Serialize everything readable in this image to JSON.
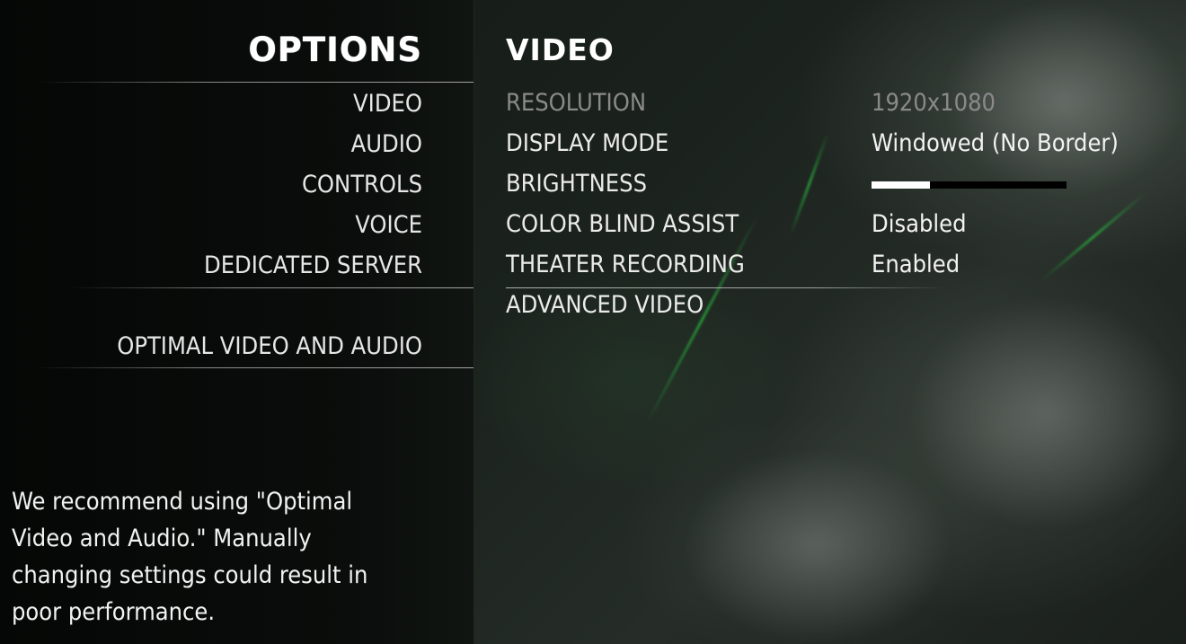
{
  "options": {
    "title": "OPTIONS",
    "menu": [
      {
        "label": "VIDEO"
      },
      {
        "label": "AUDIO"
      },
      {
        "label": "CONTROLS"
      },
      {
        "label": "VOICE"
      },
      {
        "label": "DEDICATED SERVER"
      }
    ],
    "optimal_label": "OPTIMAL VIDEO AND AUDIO",
    "hint": "We recommend using \"Optimal Video and Audio.\"  Manually changing settings could result in poor performance."
  },
  "video": {
    "title": "VIDEO",
    "settings": [
      {
        "label": "RESOLUTION",
        "value": "1920x1080",
        "disabled": true
      },
      {
        "label": "DISPLAY MODE",
        "value": "Windowed (No Border)"
      },
      {
        "label": "BRIGHTNESS",
        "value": "",
        "slider_fraction": 0.3
      },
      {
        "label": "COLOR BLIND ASSIST",
        "value": "Disabled"
      },
      {
        "label": "THEATER RECORDING",
        "value": "Enabled"
      }
    ],
    "advanced_label": "ADVANCED VIDEO"
  },
  "colors": {
    "accent_green": "#28aa3c",
    "text": "#ebebeb",
    "disabled_text": "#8a8a8a"
  }
}
